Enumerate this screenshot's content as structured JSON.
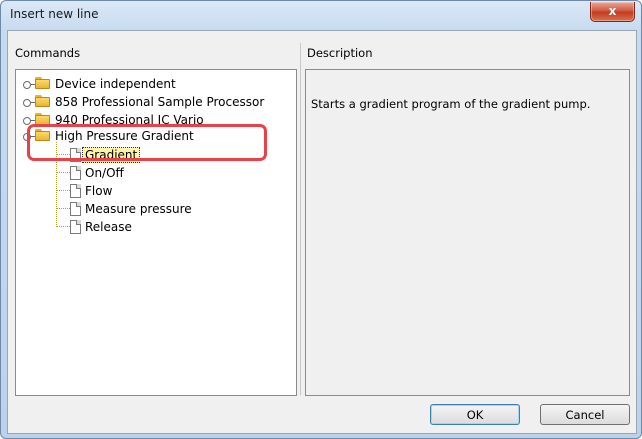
{
  "window": {
    "title": "Insert new line",
    "close_glyph": "x"
  },
  "panes": {
    "commands_label": "Commands",
    "description_label": "Description"
  },
  "tree": {
    "groups": [
      {
        "label": "Device independent"
      },
      {
        "label": "858 Professional Sample Processor"
      },
      {
        "label": "940 Professional IC Vario"
      },
      {
        "label": "High Pressure Gradient"
      }
    ],
    "children": [
      {
        "label": "Gradient",
        "selected": true
      },
      {
        "label": "On/Off"
      },
      {
        "label": "Flow"
      },
      {
        "label": "Measure pressure"
      },
      {
        "label": "Release"
      }
    ]
  },
  "description": {
    "text": "Starts a gradient program of the gradient pump."
  },
  "buttons": {
    "ok": "OK",
    "cancel": "Cancel"
  },
  "colors": {
    "highlight": "#e8414b",
    "selection": "#fff5a8",
    "folder": "#ffd966"
  }
}
